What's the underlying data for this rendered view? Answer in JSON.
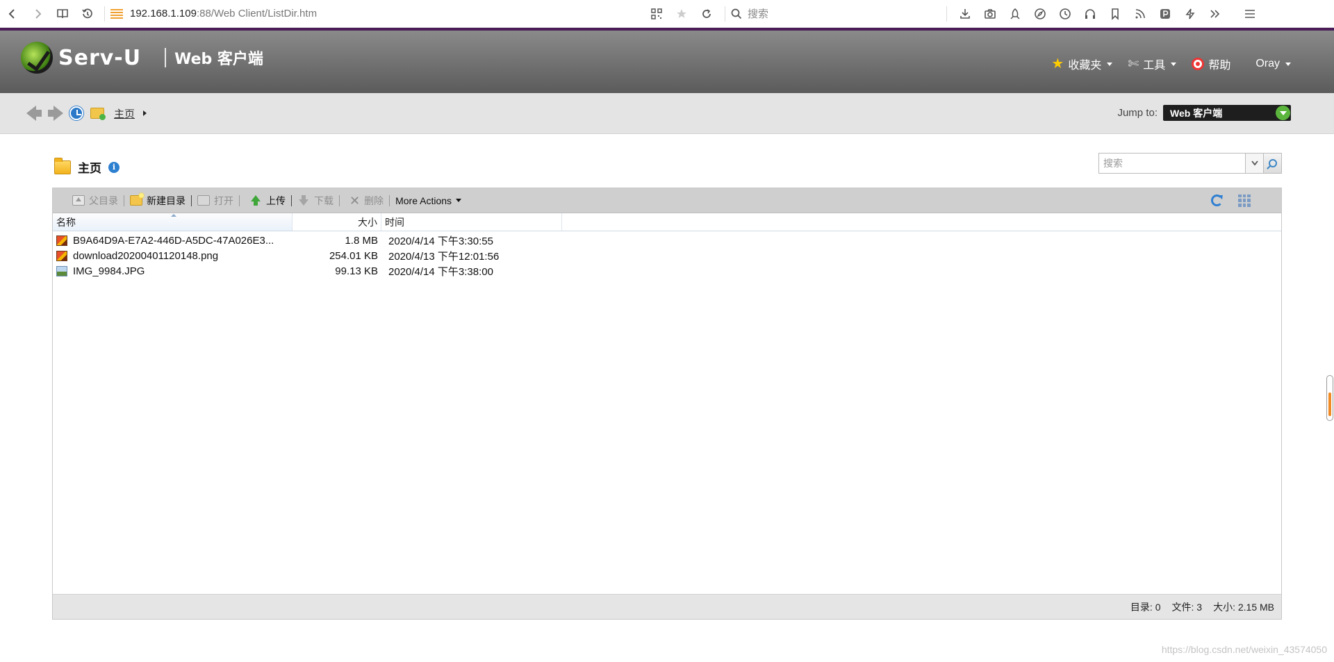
{
  "browser": {
    "url_host": "192.168.1.109",
    "url_rest": ":88/Web Client/ListDir.htm",
    "search_placeholder": "搜索",
    "icons_left": [
      "back-icon",
      "forward-icon",
      "reader-icon",
      "history-icon"
    ],
    "icons_mid": [
      "qrcode-icon",
      "star-icon",
      "reload-icon"
    ],
    "icons_right": [
      "download-icon",
      "camera-icon",
      "rocket-icon",
      "compass-icon",
      "clock-icon",
      "headphones-icon",
      "bookmark-icon",
      "rss-icon",
      "p-icon",
      "lightning-icon",
      "more-icon",
      "menu-icon"
    ]
  },
  "header": {
    "logo_text": "Serv-U",
    "subtitle": "Web 客户端",
    "menus": {
      "favorites": "收藏夹",
      "tools": "工具",
      "help": "帮助",
      "user": "Oray"
    }
  },
  "nav": {
    "breadcrumb": "主页",
    "jump_label": "Jump to:",
    "jump_value": "Web 客户端"
  },
  "folder": {
    "name": "主页",
    "info_glyph": "i"
  },
  "search": {
    "placeholder": "搜索"
  },
  "toolbar": {
    "parent_dir": "父目录",
    "new_dir": "新建目录",
    "open": "打开",
    "upload": "上传",
    "download": "下载",
    "delete": "删除",
    "more_actions": "More Actions"
  },
  "columns": {
    "name": "名称",
    "size": "大小",
    "time": "时间"
  },
  "files": [
    {
      "name": "B9A64D9A-E7A2-446D-A5DC-47A026E3...",
      "size": "1.8 MB",
      "time": "2020/4/14 下午3:30:55",
      "icon": "image-file-icon"
    },
    {
      "name": "download20200401120148.png",
      "size": "254.01 KB",
      "time": "2020/4/13 下午12:01:56",
      "icon": "image-file-icon"
    },
    {
      "name": "IMG_9984.JPG",
      "size": "99.13 KB",
      "time": "2020/4/14 下午3:38:00",
      "icon": "jpg-file-icon"
    }
  ],
  "status": {
    "dirs": "目录: 0",
    "files": "文件: 3",
    "size": "大小: 2.15 MB"
  },
  "watermark": "https://blog.csdn.net/weixin_43574050",
  "colors": {
    "header_accent": "#4a1d58",
    "jump_button": "#5bb53c",
    "link_blue": "#2d7fd0"
  }
}
